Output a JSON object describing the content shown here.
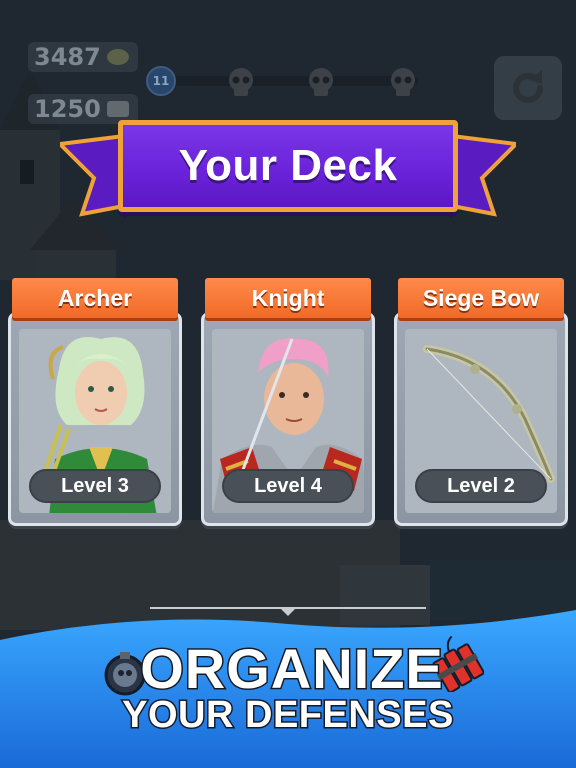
{
  "hud": {
    "resource_1": "3487",
    "resource_2": "1250",
    "player_level": "11",
    "icons": [
      "coin-icon",
      "stone-icon",
      "skull-icon",
      "refresh-icon"
    ]
  },
  "banner": {
    "title": "Your Deck"
  },
  "cards": [
    {
      "name": "Archer",
      "level": "Level 3"
    },
    {
      "name": "Knight",
      "level": "Level 4"
    },
    {
      "name": "Siege Bow",
      "level": "Level 2"
    }
  ],
  "footer": {
    "line_1": "ORGANIZE",
    "line_2": "YOUR DEFENSES"
  },
  "colors": {
    "banner_purple": "#6a22d8",
    "banner_border": "#f0a23a",
    "card_header_orange": "#f06a28",
    "footer_blue": "#2a8cf0"
  }
}
